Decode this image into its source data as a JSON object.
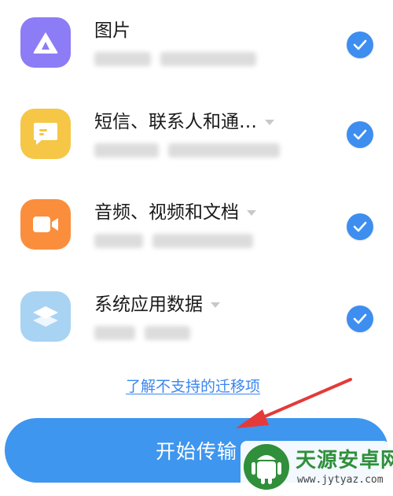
{
  "items": [
    {
      "label": "图片",
      "icon": "mountain-icon",
      "color": "#8c7cf5",
      "checked": true
    },
    {
      "label": "短信、联系人和通…",
      "icon": "message-icon",
      "color": "#f6c647",
      "checked": true
    },
    {
      "label": "音频、视频和文档",
      "icon": "video-camera-icon",
      "color": "#fb8e3c",
      "checked": true
    },
    {
      "label": "系统应用数据",
      "icon": "layers-icon",
      "color": "#a8d3f3",
      "checked": true
    }
  ],
  "unsupported_link": "了解不支持的迁移项",
  "start_button": "开始传输",
  "watermark": {
    "title": "天源安卓网",
    "url": "www.jytyaz.com"
  },
  "colors": {
    "accent": "#3e96ee",
    "check": "#3e8ef0",
    "arrow": "#e43a3a"
  }
}
